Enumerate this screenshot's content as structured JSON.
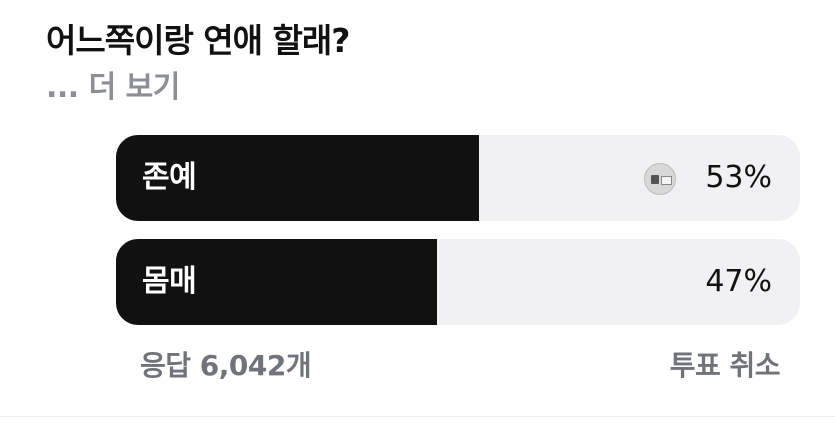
{
  "poll": {
    "question": "어느쪽이랑 연애 할래?",
    "see_more": "... 더 보기",
    "options": [
      {
        "label": "존예",
        "percent_label": "53%",
        "fill_fraction": 0.53,
        "user_voted": true,
        "voter_icon": "avatar-icon"
      },
      {
        "label": "몸매",
        "percent_label": "47%",
        "fill_fraction": 0.47,
        "user_voted": false
      }
    ],
    "responses": "응답 6,042개",
    "cancel_vote": "투표 취소"
  },
  "colors": {
    "fill": "#111111",
    "track": "#f1f1f3",
    "muted_text": "#6f737a"
  }
}
